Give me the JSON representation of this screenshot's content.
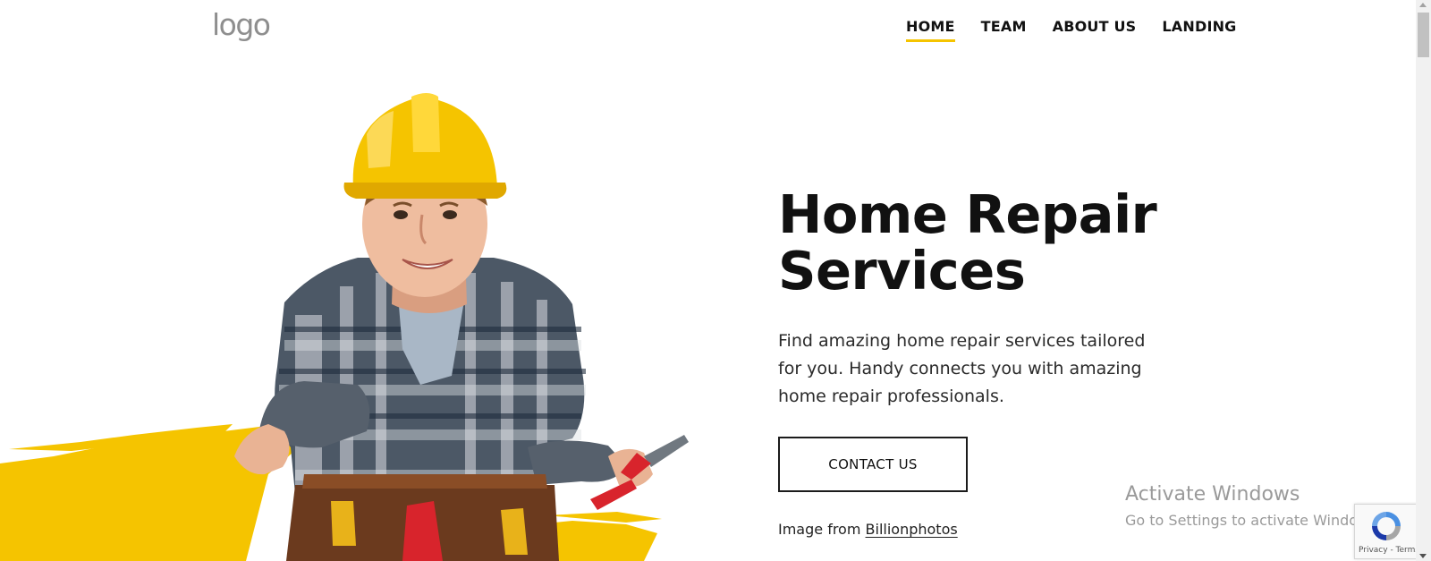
{
  "header": {
    "logo_text": "logo",
    "nav": [
      {
        "label": "HOME",
        "active": true
      },
      {
        "label": "TEAM",
        "active": false
      },
      {
        "label": "ABOUT US",
        "active": false
      },
      {
        "label": "LANDING",
        "active": false
      }
    ]
  },
  "hero": {
    "title_line1": "Home Repair",
    "title_line2": "Services",
    "description": "Find amazing home repair services tailored for you. Handy connects you with amazing home repair professionals.",
    "cta_label": "CONTACT US",
    "credit_prefix": "Image from",
    "credit_link": "Billionphotos"
  },
  "windows_watermark": {
    "title": "Activate Windows",
    "subtitle": "Go to Settings to activate Windows."
  },
  "recaptcha": {
    "terms_text": "Privacy - Terms"
  },
  "colors": {
    "accent_yellow": "#f5c400",
    "text_dark": "#111111",
    "watermark_gray": "#9a9a9a"
  },
  "icons": [
    "recaptcha-icon",
    "scroll-up-icon",
    "scroll-down-icon"
  ]
}
